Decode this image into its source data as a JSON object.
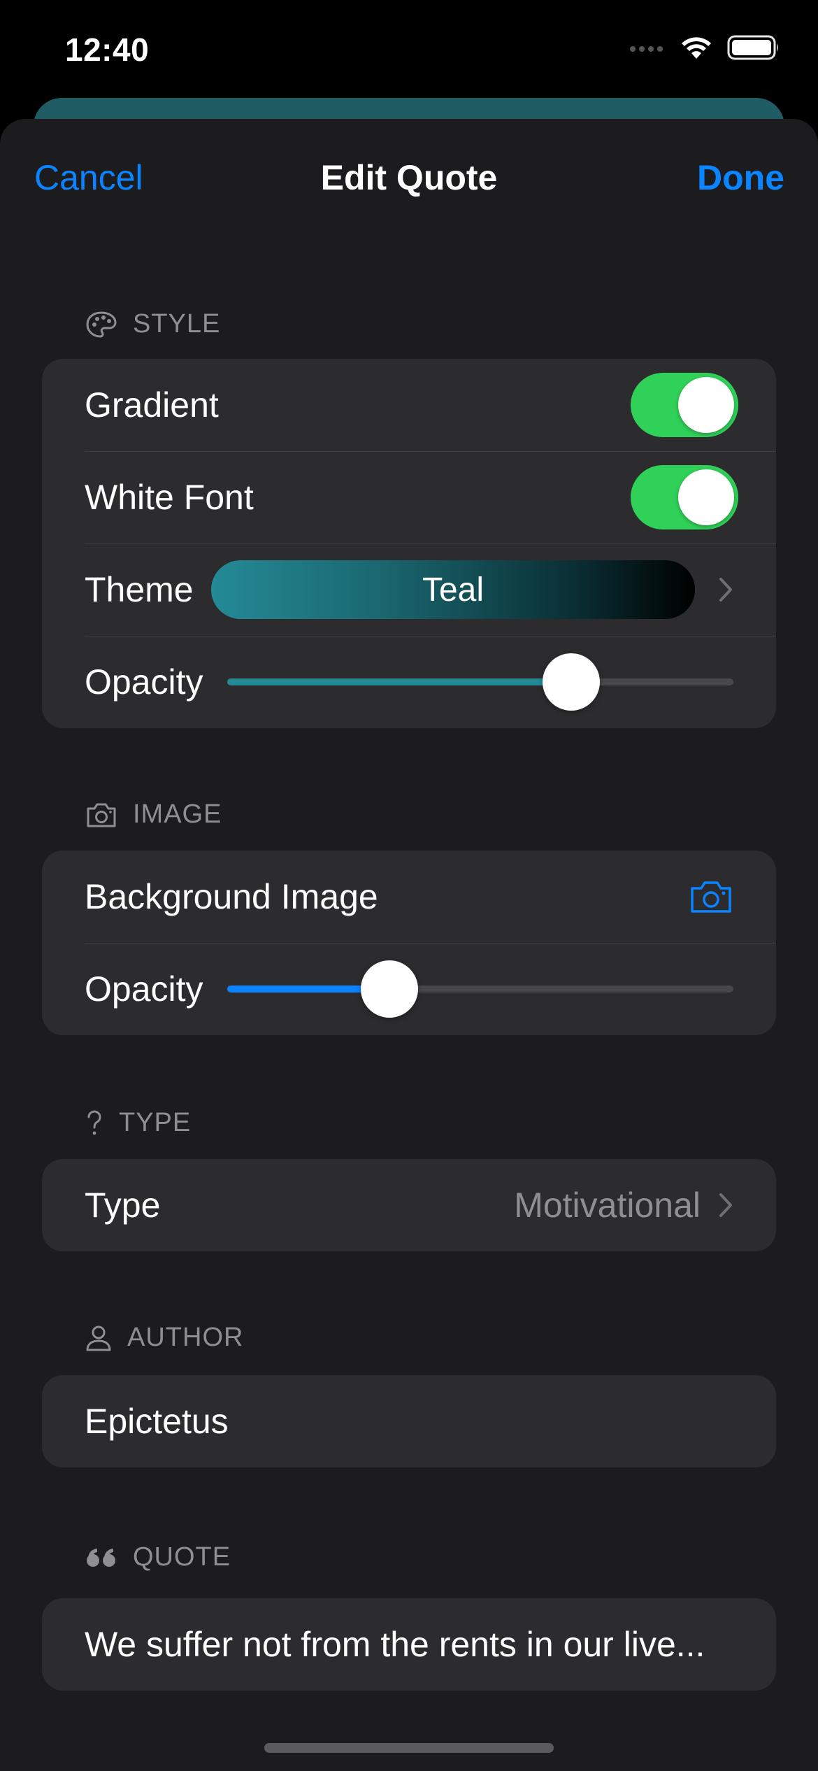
{
  "status_bar": {
    "time": "12:40"
  },
  "nav": {
    "cancel": "Cancel",
    "title": "Edit Quote",
    "done": "Done"
  },
  "style": {
    "header": "STYLE",
    "gradient_label": "Gradient",
    "gradient_on": true,
    "white_font_label": "White Font",
    "white_font_on": true,
    "theme_label": "Theme",
    "theme_value": "Teal",
    "opacity_label": "Opacity",
    "opacity_value": 0.68,
    "accent": "#248a96"
  },
  "image": {
    "header": "IMAGE",
    "background_label": "Background Image",
    "opacity_label": "Opacity",
    "opacity_value": 0.32,
    "accent": "#0a84ff"
  },
  "type": {
    "header": "TYPE",
    "label": "Type",
    "value": "Motivational"
  },
  "author": {
    "header": "AUTHOR",
    "value": "Epictetus"
  },
  "quote": {
    "header": "QUOTE",
    "value": "We suffer not from the rents in our live..."
  },
  "colors": {
    "link": "#0a84ff",
    "toggle_on": "#30d158",
    "secondary_text": "#8e8e93"
  }
}
